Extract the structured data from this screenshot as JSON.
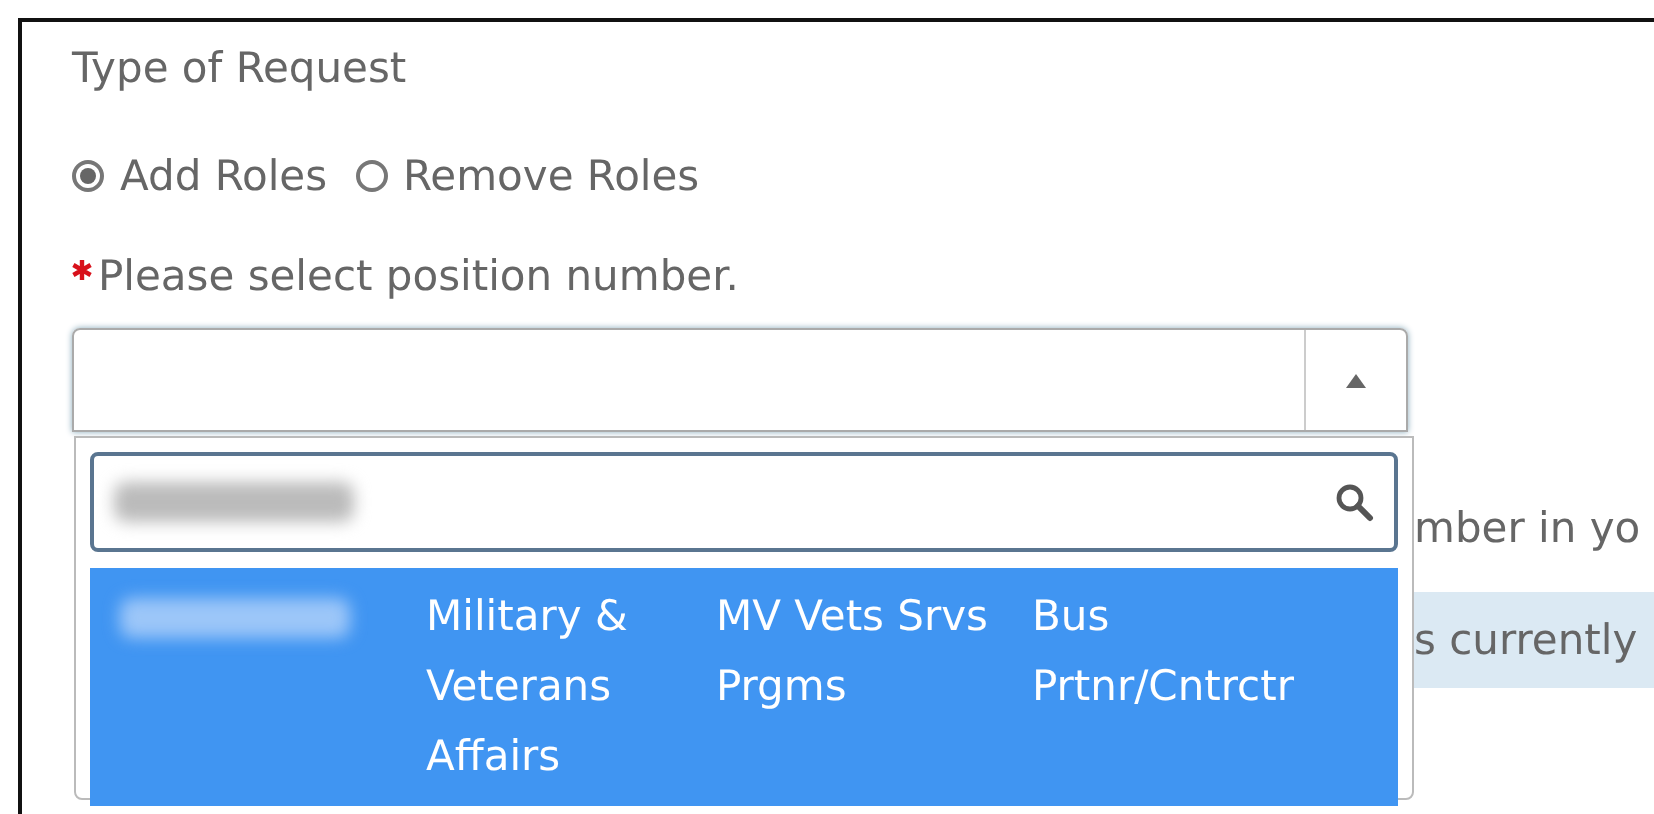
{
  "request_type": {
    "label": "Type of Request",
    "options": [
      {
        "label": "Add Roles",
        "selected": true
      },
      {
        "label": "Remove Roles",
        "selected": false
      }
    ]
  },
  "position": {
    "label": "Please select position number.",
    "required": true,
    "expanded": true,
    "options": [
      {
        "columns": [
          "Military & Veterans Affairs",
          "MV Vets Srvs Prgms",
          "Bus Prtnr/Cntrctr"
        ],
        "selected": true
      }
    ]
  },
  "behind": {
    "line": "mber in yo",
    "notice": "s currently"
  }
}
